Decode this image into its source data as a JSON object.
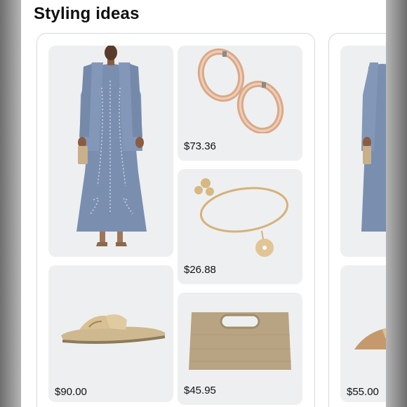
{
  "section": {
    "title": "Styling ideas"
  },
  "outfits": [
    {
      "items": [
        {
          "name": "Blue beaded dress with jacket",
          "price": ""
        },
        {
          "name": "Rose gold hoop earrings",
          "price": "$73.36"
        },
        {
          "name": "Gold charm bangle bracelet",
          "price": "$26.88"
        },
        {
          "name": "Gold strappy slide sandal",
          "price": "$90.00"
        },
        {
          "name": "Straw clutch bag",
          "price": "$45.95"
        }
      ]
    },
    {
      "items": [
        {
          "name": "Blue beaded dress with jacket",
          "price": ""
        },
        {
          "name": "Gold slide sandal",
          "price": "$55.00"
        }
      ]
    }
  ],
  "colors": {
    "background": "#ffffff",
    "tile": "#eeeff0",
    "text": "#0f1111",
    "border": "#d5d9d9"
  }
}
